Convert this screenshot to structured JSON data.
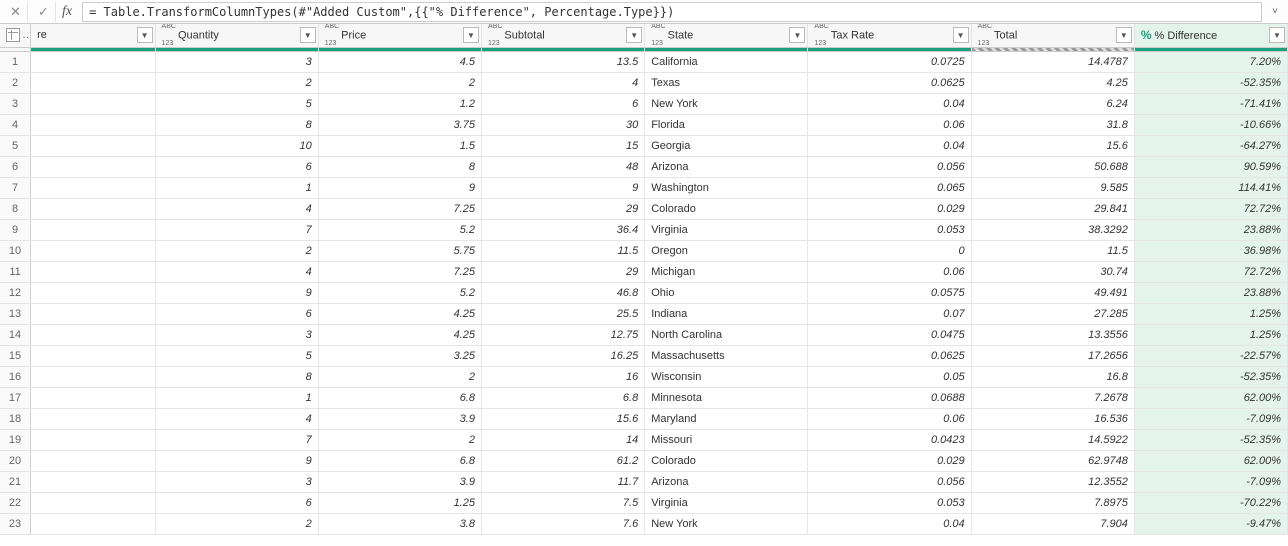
{
  "formulaBar": {
    "cancelIcon": "✕",
    "confirmIcon": "✓",
    "fxLabel": "fx",
    "formula": "= Table.TransformColumnTypes(#\"Added Custom\",{{\"% Difference\", Percentage.Type}})",
    "expandIcon": "˅"
  },
  "columns": [
    {
      "key": "re",
      "label": "re",
      "typeIcon": "",
      "cssClass": "col-re",
      "align": "txt",
      "highlight": false
    },
    {
      "key": "qty",
      "label": "Quantity",
      "typeIcon": "abc123",
      "cssClass": "col-qty",
      "align": "num",
      "highlight": false
    },
    {
      "key": "price",
      "label": "Price",
      "typeIcon": "abc123",
      "cssClass": "col-price",
      "align": "num",
      "highlight": false
    },
    {
      "key": "sub",
      "label": "Subtotal",
      "typeIcon": "abc123",
      "cssClass": "col-sub",
      "align": "num",
      "highlight": false
    },
    {
      "key": "state",
      "label": "State",
      "typeIcon": "abc123",
      "cssClass": "col-state",
      "align": "txt",
      "highlight": false
    },
    {
      "key": "tax",
      "label": "Tax Rate",
      "typeIcon": "abc123",
      "cssClass": "col-tax",
      "align": "num",
      "highlight": false
    },
    {
      "key": "total",
      "label": "Total",
      "typeIcon": "abc123",
      "cssClass": "col-total",
      "align": "num",
      "highlight": false
    },
    {
      "key": "diff",
      "label": "% Difference",
      "typeIcon": "pct",
      "cssClass": "col-diff",
      "align": "num",
      "highlight": true
    }
  ],
  "rows": [
    {
      "n": "1",
      "re": "",
      "qty": "3",
      "price": "4.5",
      "sub": "13.5",
      "state": "California",
      "tax": "0.0725",
      "total": "14.4787",
      "diff": "7.20%"
    },
    {
      "n": "2",
      "re": "",
      "qty": "2",
      "price": "2",
      "sub": "4",
      "state": "Texas",
      "tax": "0.0625",
      "total": "4.25",
      "diff": "-52.35%"
    },
    {
      "n": "3",
      "re": "",
      "qty": "5",
      "price": "1.2",
      "sub": "6",
      "state": "New York",
      "tax": "0.04",
      "total": "6.24",
      "diff": "-71.41%"
    },
    {
      "n": "4",
      "re": "",
      "qty": "8",
      "price": "3.75",
      "sub": "30",
      "state": "Florida",
      "tax": "0.06",
      "total": "31.8",
      "diff": "-10.66%"
    },
    {
      "n": "5",
      "re": "",
      "qty": "10",
      "price": "1.5",
      "sub": "15",
      "state": "Georgia",
      "tax": "0.04",
      "total": "15.6",
      "diff": "-64.27%"
    },
    {
      "n": "6",
      "re": "",
      "qty": "6",
      "price": "8",
      "sub": "48",
      "state": "Arizona",
      "tax": "0.056",
      "total": "50.688",
      "diff": "90.59%"
    },
    {
      "n": "7",
      "re": "",
      "qty": "1",
      "price": "9",
      "sub": "9",
      "state": "Washington",
      "tax": "0.065",
      "total": "9.585",
      "diff": "114.41%"
    },
    {
      "n": "8",
      "re": "",
      "qty": "4",
      "price": "7.25",
      "sub": "29",
      "state": "Colorado",
      "tax": "0.029",
      "total": "29.841",
      "diff": "72.72%"
    },
    {
      "n": "9",
      "re": "",
      "qty": "7",
      "price": "5.2",
      "sub": "36.4",
      "state": "Virginia",
      "tax": "0.053",
      "total": "38.3292",
      "diff": "23.88%"
    },
    {
      "n": "10",
      "re": "",
      "qty": "2",
      "price": "5.75",
      "sub": "11.5",
      "state": "Oregon",
      "tax": "0",
      "total": "11.5",
      "diff": "36.98%"
    },
    {
      "n": "11",
      "re": "",
      "qty": "4",
      "price": "7.25",
      "sub": "29",
      "state": "Michigan",
      "tax": "0.06",
      "total": "30.74",
      "diff": "72.72%"
    },
    {
      "n": "12",
      "re": "",
      "qty": "9",
      "price": "5.2",
      "sub": "46.8",
      "state": "Ohio",
      "tax": "0.0575",
      "total": "49.491",
      "diff": "23.88%"
    },
    {
      "n": "13",
      "re": "",
      "qty": "6",
      "price": "4.25",
      "sub": "25.5",
      "state": "Indiana",
      "tax": "0.07",
      "total": "27.285",
      "diff": "1.25%"
    },
    {
      "n": "14",
      "re": "",
      "qty": "3",
      "price": "4.25",
      "sub": "12.75",
      "state": "North Carolina",
      "tax": "0.0475",
      "total": "13.3556",
      "diff": "1.25%"
    },
    {
      "n": "15",
      "re": "",
      "qty": "5",
      "price": "3.25",
      "sub": "16.25",
      "state": "Massachusetts",
      "tax": "0.0625",
      "total": "17.2656",
      "diff": "-22.57%"
    },
    {
      "n": "16",
      "re": "",
      "qty": "8",
      "price": "2",
      "sub": "16",
      "state": "Wisconsin",
      "tax": "0.05",
      "total": "16.8",
      "diff": "-52.35%"
    },
    {
      "n": "17",
      "re": "",
      "qty": "1",
      "price": "6.8",
      "sub": "6.8",
      "state": "Minnesota",
      "tax": "0.0688",
      "total": "7.2678",
      "diff": "62.00%"
    },
    {
      "n": "18",
      "re": "",
      "qty": "4",
      "price": "3.9",
      "sub": "15.6",
      "state": "Maryland",
      "tax": "0.06",
      "total": "16.536",
      "diff": "-7.09%"
    },
    {
      "n": "19",
      "re": "",
      "qty": "7",
      "price": "2",
      "sub": "14",
      "state": "Missouri",
      "tax": "0.0423",
      "total": "14.5922",
      "diff": "-52.35%"
    },
    {
      "n": "20",
      "re": "",
      "qty": "9",
      "price": "6.8",
      "sub": "61.2",
      "state": "Colorado",
      "tax": "0.029",
      "total": "62.9748",
      "diff": "62.00%"
    },
    {
      "n": "21",
      "re": "",
      "qty": "3",
      "price": "3.9",
      "sub": "11.7",
      "state": "Arizona",
      "tax": "0.056",
      "total": "12.3552",
      "diff": "-7.09%"
    },
    {
      "n": "22",
      "re": "",
      "qty": "6",
      "price": "1.25",
      "sub": "7.5",
      "state": "Virginia",
      "tax": "0.053",
      "total": "7.8975",
      "diff": "-70.22%"
    },
    {
      "n": "23",
      "re": "",
      "qty": "2",
      "price": "3.8",
      "sub": "7.6",
      "state": "New York",
      "tax": "0.04",
      "total": "7.904",
      "diff": "-9.47%"
    }
  ]
}
